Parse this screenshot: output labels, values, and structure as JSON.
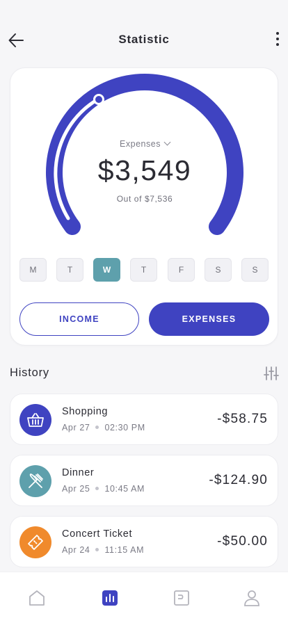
{
  "header": {
    "title": "Statistic",
    "back_icon": "arrow-left-icon",
    "more_icon": "more-vertical-icon"
  },
  "summary": {
    "label": "Expenses",
    "amount": "$3,549",
    "subtitle": "Out of $7,536",
    "progress_fraction": 0.47,
    "accent_color": "#3f43c1"
  },
  "days": [
    {
      "label": "M",
      "active": false
    },
    {
      "label": "T",
      "active": false
    },
    {
      "label": "W",
      "active": true
    },
    {
      "label": "T",
      "active": false
    },
    {
      "label": "F",
      "active": false
    },
    {
      "label": "S",
      "active": false
    },
    {
      "label": "S",
      "active": false
    }
  ],
  "toggle": {
    "income_label": "INCOME",
    "expenses_label": "EXPENSES",
    "selected": "EXPENSES"
  },
  "history": {
    "title": "History",
    "filter_icon": "sliders-icon",
    "items": [
      {
        "name": "Shopping",
        "date": "Apr 27",
        "time": "02:30 PM",
        "amount": "-$58.75",
        "icon": "basket-icon",
        "color": "#3f43c1"
      },
      {
        "name": "Dinner",
        "date": "Apr 25",
        "time": "10:45 AM",
        "amount": "-$124.90",
        "icon": "fork-knife-icon",
        "color": "#5ea0ac"
      },
      {
        "name": "Concert Ticket",
        "date": "Apr 24",
        "time": "11:15 AM",
        "amount": "-$50.00",
        "icon": "ticket-icon",
        "color": "#f08a2c"
      }
    ]
  },
  "tabbar": {
    "tabs": [
      {
        "name": "home",
        "icon": "home-icon",
        "active": false
      },
      {
        "name": "statistics",
        "icon": "bar-chart-icon",
        "active": true
      },
      {
        "name": "wallet",
        "icon": "wallet-icon",
        "active": false
      },
      {
        "name": "profile",
        "icon": "user-icon",
        "active": false
      }
    ]
  }
}
